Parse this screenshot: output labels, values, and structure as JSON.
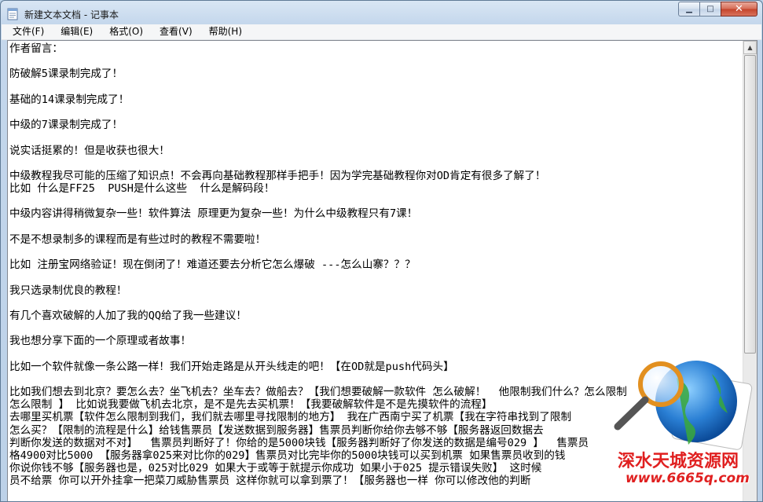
{
  "window": {
    "title": "新建文本文档 - 记事本",
    "buttons": {
      "minimize": "▁",
      "maximize": "□",
      "close": "✕"
    }
  },
  "menu": [
    "文件(F)",
    "编辑(E)",
    "格式(O)",
    "查看(V)",
    "帮助(H)"
  ],
  "document": {
    "lines": [
      "作者留言：",
      "",
      "防破解5课录制完成了！",
      "",
      "基础的14课录制完成了！",
      "",
      "中级的7课录制完成了！",
      "",
      "说实话挺累的！但是收获也很大！",
      "",
      "中级教程我尽可能的压缩了知识点！不会再向基础教程那样手把手！因为学完基础教程你对OD肯定有很多了解了！",
      "比如 什么是FF25  PUSH是什么这些  什么是解码段！",
      "",
      "中级内容讲得稍微复杂一些！软件算法 原理更为复杂一些！为什么中级教程只有7课！",
      "",
      "不是不想录制多的课程而是有些过时的教程不需要啦！",
      "",
      "比如 注册宝网络验证！现在倒闭了！难道还要去分析它怎么爆破 ---怎么山寨？？？",
      "",
      "我只选录制优良的教程！",
      "",
      "有几个喜欢破解的人加了我的QQ给了我一些建议！",
      "",
      "我也想分享下面的一个原理或者故事！",
      "",
      "比如一个软件就像一条公路一样！我们开始走路是从开头线走的吧！【在OD就是push代码头】",
      "",
      "比如我们想去到北京？要怎么去？坐飞机去？坐车去？做船去？【我们想要破解一款软件 怎么破解！  他限制我们什么？怎么限制",
      "怎么限制 】 比如说我要做飞机去北京，是不是先去买机票！【我要破解软件是不是先摸软件的流程】",
      "去哪里买机票【软件怎么限制到我们，我们就去哪里寻找限制的地方】 我在广西南宁买了机票【我在字符串找到了限制",
      "怎么买？【限制的流程是什么】给钱售票员【发送数据到服务器】售票员判断你给你去够不够【服务器返回数据去",
      "判断你发送的数据对不对】  售票员判断好了！你给的是5000块钱【服务器判断好了你发送的数据是编号029 】  售票员",
      "格4900对比5000 【服务器拿025来对比你的029】售票员对比完毕你的5000块钱可以买到机票 如果售票员收到的钱",
      "你说你钱不够【服务器也是，025对比029 如果大于或等于就提示你成功 如果小于025 提示错误失败】 这时候",
      "员不给票 你可以开外挂拿一把菜刀威胁售票员 这样你就可以拿到票了！【服务器也一样 你可以修改他的判断"
    ]
  },
  "watermark": {
    "text": "深水天城资源网",
    "url": "www.6665q.com"
  }
}
